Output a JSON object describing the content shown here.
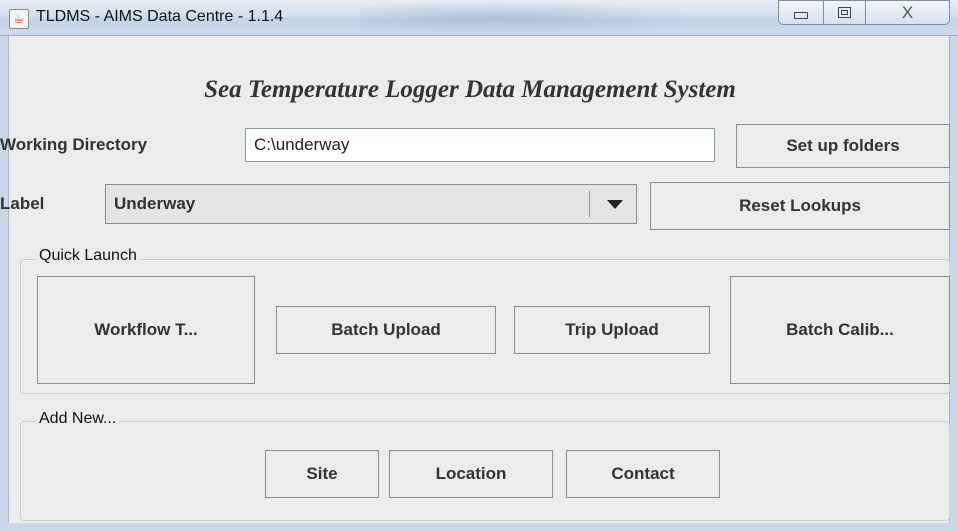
{
  "window": {
    "title": "TLDMS - AIMS Data Centre - 1.1.4",
    "icon": "java-coffee-cup-icon",
    "controls": {
      "minimize": "minimize-icon",
      "maximize": "maximize-icon",
      "close": "close-icon",
      "close_glyph": "X"
    }
  },
  "header": {
    "title": "Sea Temperature Logger Data Management System"
  },
  "working_directory": {
    "label": "Working Directory",
    "value": "C:\\underway",
    "button": "Set up folders"
  },
  "label_row": {
    "label": "Label",
    "selected": "Underway",
    "reset_button": "Reset Lookups"
  },
  "quick_launch": {
    "title": "Quick Launch",
    "buttons": [
      "Workflow T...",
      "Batch Upload",
      "Trip Upload",
      "Batch Calib..."
    ]
  },
  "add_new": {
    "title": "Add New...",
    "buttons": [
      "Site",
      "Location",
      "Contact"
    ]
  },
  "colors": {
    "titlebar": "#d3dfee",
    "background": "#ececec",
    "text": "#333333"
  }
}
